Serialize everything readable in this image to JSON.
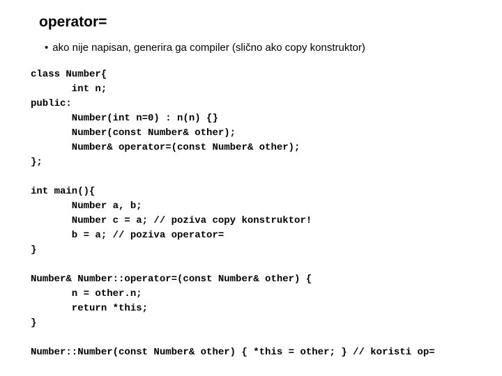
{
  "title": "operator=",
  "bullet": "ako nije napisan, generira ga compiler (slično ako copy konstruktor)",
  "code": {
    "l01": "class Number{",
    "l02": "       int n;",
    "l03": "public:",
    "l04": "       Number(int n=0) : n(n) {}",
    "l05": "       Number(const Number& other);",
    "l06": "       Number& operator=(const Number& other);",
    "l07": "};",
    "l08": "",
    "l09": "int main(){",
    "l10": "       Number a, b;",
    "l11": "       Number c = a; // poziva copy konstruktor!",
    "l12": "       b = a; // poziva operator=",
    "l13": "}",
    "l14": "",
    "l15": "Number& Number::operator=(const Number& other) {",
    "l16": "       n = other.n;",
    "l17": "       return *this;",
    "l18": "}",
    "l19": "",
    "l20": "Number::Number(const Number& other) { *this = other; } // koristi op="
  }
}
